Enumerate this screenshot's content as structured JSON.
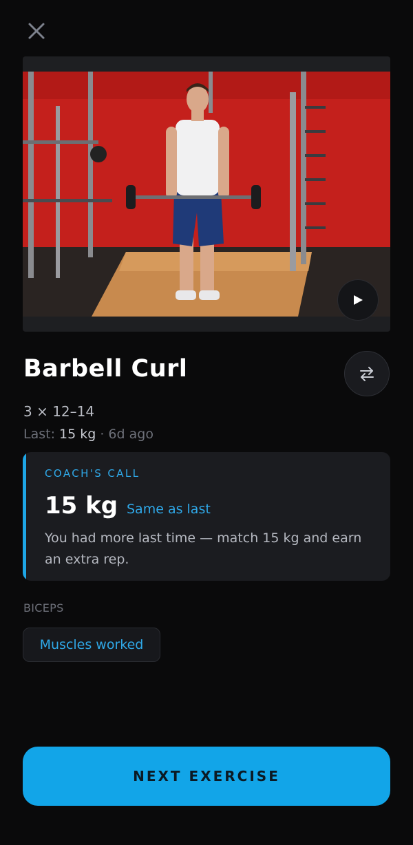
{
  "header": {
    "close_icon": "close-icon"
  },
  "video": {
    "play_icon": "play-icon"
  },
  "exercise": {
    "title": "Barbell Curl",
    "sets_reps": "3 × 12–14",
    "last_prefix": "Last: ",
    "last_weight": "15 kg",
    "last_suffix": " · 6d ago",
    "swap_icon": "swap-icon"
  },
  "coach": {
    "label": "COACH'S CALL",
    "weight": "15 kg",
    "status": "Same as last",
    "message": "You had more last time — match 15 kg and earn an extra rep."
  },
  "muscles": {
    "group": "BICEPS",
    "button_label": "Muscles worked"
  },
  "footer": {
    "next_label": "NEXT EXERCISE"
  },
  "colors": {
    "accent": "#12a5e8",
    "background": "#0a0a0b",
    "card": "#1b1c20"
  }
}
